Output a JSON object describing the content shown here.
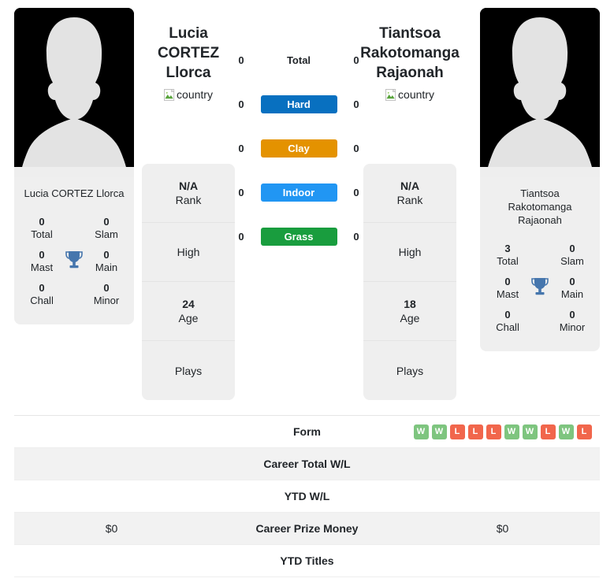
{
  "players": {
    "left": {
      "name_header": "Lucia\nCORTEZ\nLlorca",
      "name_line1": "Lucia",
      "name_line2": "CORTEZ",
      "name_line3": "Llorca",
      "country_alt": "country",
      "photo_alt": "player photo",
      "card_name": "Lucia CORTEZ Llorca",
      "titles": {
        "total_value": "0",
        "total_label": "Total",
        "slam_value": "0",
        "slam_label": "Slam",
        "mast_value": "0",
        "mast_label": "Mast",
        "main_value": "0",
        "main_label": "Main",
        "chall_value": "0",
        "chall_label": "Chall",
        "minor_value": "0",
        "minor_label": "Minor"
      },
      "stats": [
        {
          "value": "N/A",
          "label": "Rank"
        },
        {
          "value": "",
          "label": "High"
        },
        {
          "value": "24",
          "label": "Age"
        },
        {
          "value": "",
          "label": "Plays"
        }
      ]
    },
    "right": {
      "name_line1": "Tiantsoa",
      "name_line2": "Rakotomanga",
      "name_line3": "Rajaonah",
      "country_alt": "country",
      "photo_alt": "player photo",
      "card_name_line1": "Tiantsoa",
      "card_name_line2": "Rakotomanga",
      "card_name_line3": "Rajaonah",
      "titles": {
        "total_value": "3",
        "total_label": "Total",
        "slam_value": "0",
        "slam_label": "Slam",
        "mast_value": "0",
        "mast_label": "Mast",
        "main_value": "0",
        "main_label": "Main",
        "chall_value": "0",
        "chall_label": "Chall",
        "minor_value": "0",
        "minor_label": "Minor"
      },
      "stats": [
        {
          "value": "N/A",
          "label": "Rank"
        },
        {
          "value": "",
          "label": "High"
        },
        {
          "value": "18",
          "label": "Age"
        },
        {
          "value": "",
          "label": "Plays"
        }
      ]
    }
  },
  "surfaces": [
    {
      "label": "Total",
      "left_value": "0",
      "right_value": "0",
      "color": "transparent",
      "plain": true
    },
    {
      "label": "Hard",
      "left_value": "0",
      "right_value": "0",
      "color": "#0870c0",
      "plain": false
    },
    {
      "label": "Clay",
      "left_value": "0",
      "right_value": "0",
      "color": "#e49200",
      "plain": false
    },
    {
      "label": "Indoor",
      "left_value": "0",
      "right_value": "0",
      "color": "#2196f3",
      "plain": false
    },
    {
      "label": "Grass",
      "left_value": "0",
      "right_value": "0",
      "color": "#199d3e",
      "plain": false
    }
  ],
  "comparison_rows": [
    {
      "label": "Form",
      "left_text": "",
      "right_text": "",
      "right_form": [
        "W",
        "W",
        "L",
        "L",
        "L",
        "W",
        "W",
        "L",
        "W",
        "L"
      ],
      "left_form": [],
      "striped": false
    },
    {
      "label": "Career Total W/L",
      "left_text": "",
      "right_text": "",
      "left_form": [],
      "right_form": [],
      "striped": true
    },
    {
      "label": "YTD W/L",
      "left_text": "",
      "right_text": "",
      "left_form": [],
      "right_form": [],
      "striped": false
    },
    {
      "label": "Career Prize Money",
      "left_text": "$0",
      "right_text": "$0",
      "left_form": [],
      "right_form": [],
      "striped": true
    },
    {
      "label": "YTD Titles",
      "left_text": "",
      "right_text": "",
      "left_form": [],
      "right_form": [],
      "striped": false
    }
  ],
  "colors": {
    "hard": "#0870c0",
    "clay": "#e49200",
    "indoor": "#2196f3",
    "grass": "#199d3e",
    "win_badge": "#7ec57f",
    "loss_badge": "#f1664c",
    "panel_bg": "#efefef",
    "stripe_bg": "#f2f2f2",
    "trophy": "#4676ad"
  }
}
